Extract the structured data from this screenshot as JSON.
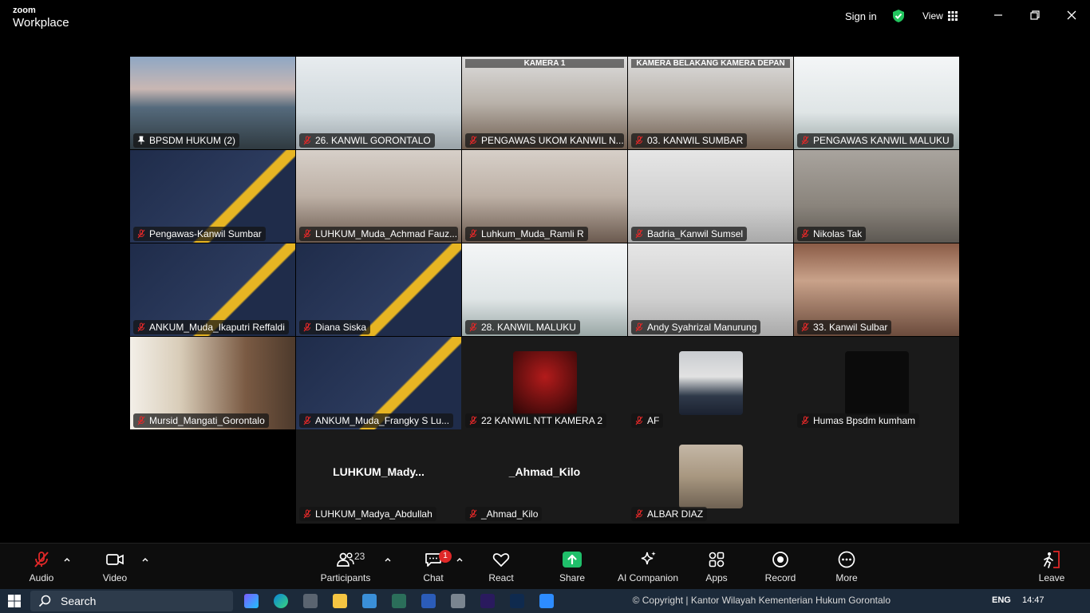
{
  "app": {
    "brand_top": "zoom",
    "brand_bottom": "Workplace",
    "sign_in": "Sign in",
    "view": "View"
  },
  "participants": [
    {
      "name": "BPSDM HUKUM (2)",
      "pinned": true,
      "bg": "sea",
      "banner": ""
    },
    {
      "name": "26. KANWIL GORONTALO",
      "bg": "office",
      "banner": ""
    },
    {
      "name": "PENGAWAS UKOM KANWIL N...",
      "bg": "room",
      "banner": "KAMERA 1"
    },
    {
      "name": "03. KANWIL SUMBAR",
      "bg": "room",
      "banner": "KAMERA BELAKANG KAMERA DEPAN"
    },
    {
      "name": "PENGAWAS KANWIL MALUKU",
      "bg": "bright",
      "banner": ""
    },
    {
      "name": "Pengawas-Kanwil Sumbar",
      "bg": "navy",
      "banner": ""
    },
    {
      "name": "LUHKUM_Muda_Achmad Fauz...",
      "bg": "indoor",
      "banner": ""
    },
    {
      "name": "Luhkum_Muda_Ramli R",
      "bg": "indoor",
      "banner": ""
    },
    {
      "name": "Badria_Kanwil Sumsel",
      "bg": "blur",
      "banner": ""
    },
    {
      "name": "Nikolas Tak",
      "bg": "grey",
      "banner": ""
    },
    {
      "name": "ANKUM_Muda_Ikaputri Reffaldi",
      "bg": "navy",
      "banner": ""
    },
    {
      "name": "Diana Siska",
      "bg": "navy",
      "banner": ""
    },
    {
      "name": "28. KANWIL MALUKU",
      "bg": "bright",
      "banner": ""
    },
    {
      "name": "Andy Syahrizal Manurung",
      "bg": "blur",
      "banner": ""
    },
    {
      "name": "33. Kanwil Sulbar",
      "bg": "office-red",
      "banner": ""
    },
    {
      "name": "Mursid_Mangati_Gorontalo",
      "bg": "library",
      "banner": ""
    },
    {
      "name": "ANKUM_Muda_Frangky S Lu...",
      "bg": "navy-small",
      "banner": ""
    },
    {
      "name": "22 KANWIL NTT KAMERA 2",
      "bg": "avatar-kemenkumham",
      "banner": ""
    },
    {
      "name": "AF",
      "bg": "avatar-photo",
      "banner": ""
    },
    {
      "name": "Humas Bpsdm kumham",
      "bg": "avatar-bpsdm",
      "banner": ""
    },
    {
      "name": "LUHKUM_Madya_Abdullah",
      "bg": "text",
      "big": "LUHKUM_Mady...",
      "banner": ""
    },
    {
      "name": "_Ahmad_Kilo",
      "bg": "text",
      "big": "_Ahmad_Kilo",
      "banner": ""
    },
    {
      "name": "ALBAR DIAZ",
      "bg": "avatar-photo2",
      "banner": ""
    }
  ],
  "toolbar": {
    "audio": "Audio",
    "video": "Video",
    "participants": "Participants",
    "participant_count": "23",
    "chat": "Chat",
    "chat_badge": "1",
    "react": "React",
    "share": "Share",
    "ai": "AI Companion",
    "apps": "Apps",
    "record": "Record",
    "more": "More",
    "leave": "Leave"
  },
  "taskbar": {
    "search": "Search",
    "tray_text": "© Copyright | Kantor Wilayah Kementerian Hukum Gorontalo",
    "lang": "ENG",
    "time": "14:47"
  },
  "colors": {
    "share_green": "#1fbf6a",
    "active_border": "#4dd17a",
    "muted_red": "#e02828"
  }
}
